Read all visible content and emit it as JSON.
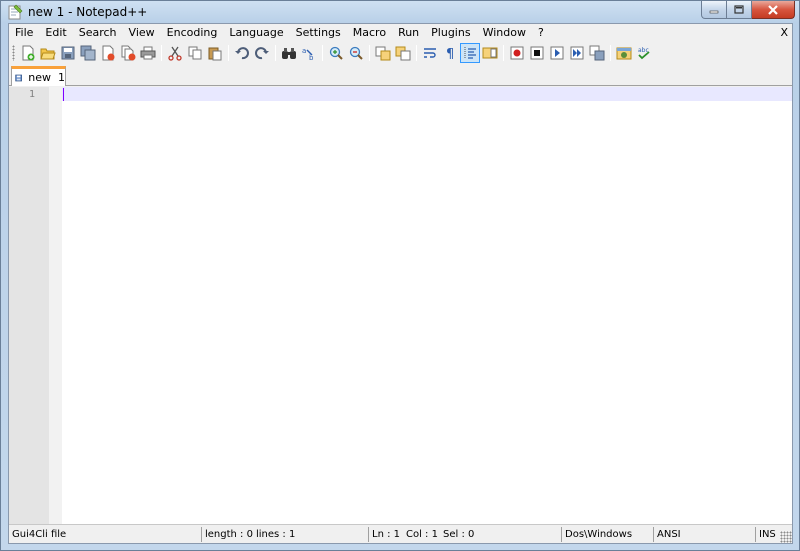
{
  "window": {
    "title": "new  1 - Notepad++",
    "icon": "notepadpp-icon"
  },
  "menubar": {
    "items": [
      "File",
      "Edit",
      "Search",
      "View",
      "Encoding",
      "Language",
      "Settings",
      "Macro",
      "Run",
      "Plugins",
      "Window",
      "?"
    ],
    "close_label": "X"
  },
  "toolbar": {
    "buttons": [
      "new-file",
      "open-file",
      "save",
      "save-all",
      "close",
      "close-all",
      "print",
      "cut",
      "copy",
      "paste",
      "undo",
      "redo",
      "find",
      "replace",
      "zoom-in",
      "zoom-out",
      "sync-vertical",
      "sync-horizontal",
      "word-wrap",
      "show-all-chars",
      "indent-guide",
      "doc-map",
      "record-macro",
      "stop-record",
      "play-macro",
      "run-macro-multiple",
      "save-macro",
      "launch-browser",
      "spell-check"
    ],
    "pressed": "indent-guide"
  },
  "tabs": [
    {
      "label": "new  1",
      "icon": "saved-file-icon",
      "active": true
    }
  ],
  "editor": {
    "line_numbers": [
      "1"
    ],
    "content": ""
  },
  "statusbar": {
    "file_type": "Gui4Cli file",
    "length": "length : 0",
    "lines": "lines : 1",
    "ln": "Ln : 1",
    "col": "Col : 1",
    "sel": "Sel : 0",
    "eol": "Dos\\Windows",
    "encoding": "ANSI",
    "mode": "INS"
  },
  "colors": {
    "tab_accent": "#f9a13a",
    "current_line": "#e8e8ff",
    "caret": "#8000ff",
    "gutter": "#e4e4e4"
  }
}
